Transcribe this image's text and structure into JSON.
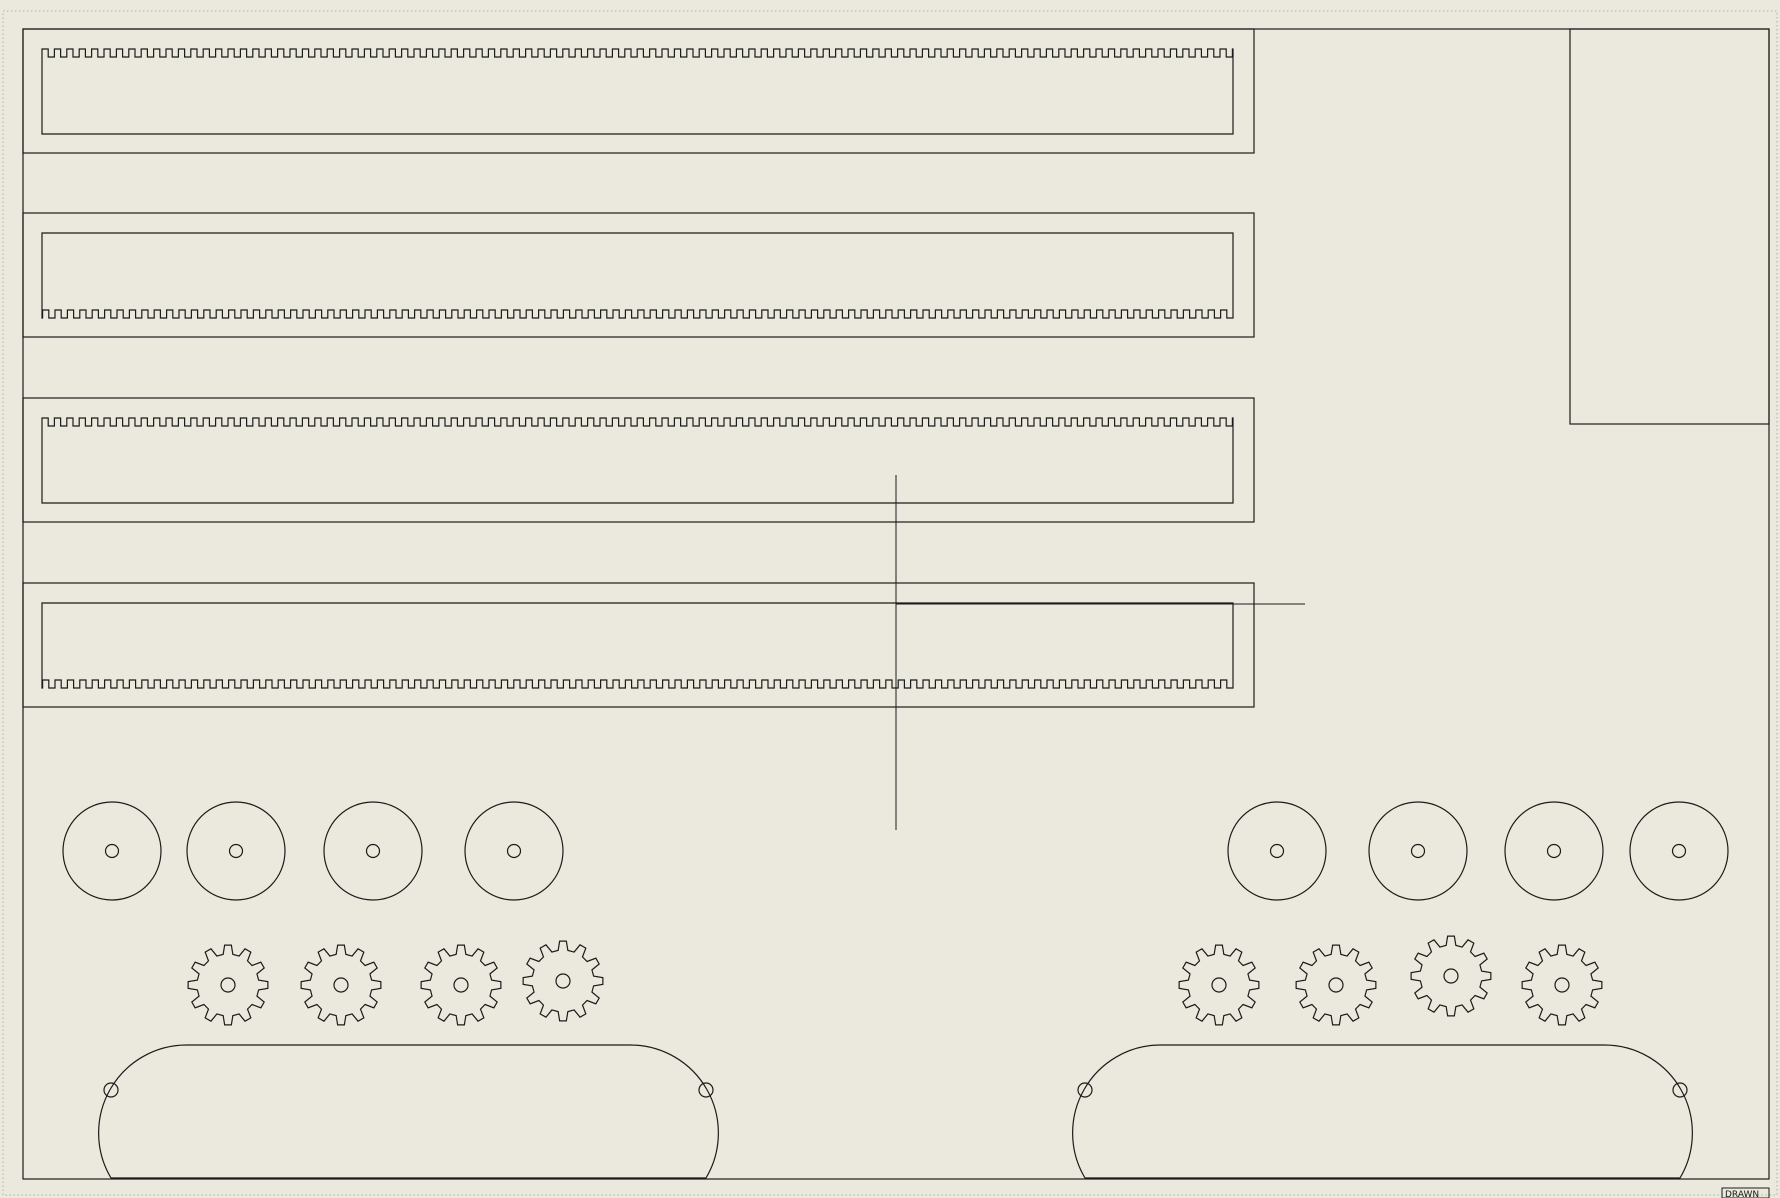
{
  "drawing": {
    "title_block": {
      "drawn_label": "DRAWN"
    }
  }
}
